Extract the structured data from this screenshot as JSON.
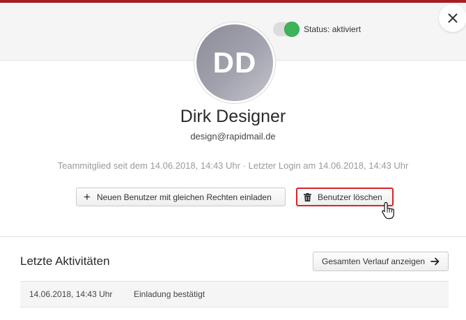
{
  "status": {
    "label": "Status: aktiviert",
    "active": true
  },
  "user": {
    "initials": "DD",
    "name": "Dirk Designer",
    "email": "design@rapidmail.de",
    "member_info": "Teammitglied seit dem 14.06.2018, 14:43 Uhr · Letzter Login am 14.06.2018, 14:43 Uhr"
  },
  "actions": {
    "invite_label": "Neuen Benutzer mit gleichen Rechten einladen",
    "delete_label": "Benutzer löschen"
  },
  "activities": {
    "title": "Letzte Aktivitäten",
    "history_button": "Gesamten Verlauf anzeigen",
    "rows": [
      {
        "time": "14.06.2018, 14:43 Uhr",
        "description": "Einladung bestätigt"
      }
    ]
  },
  "colors": {
    "accent": "#a31f23",
    "toggle_on": "#3cb45a",
    "delete_highlight": "#d9232a"
  },
  "icons": [
    "close-icon",
    "plus-icon",
    "trash-icon",
    "arrow-right-icon",
    "hand-cursor-icon"
  ]
}
